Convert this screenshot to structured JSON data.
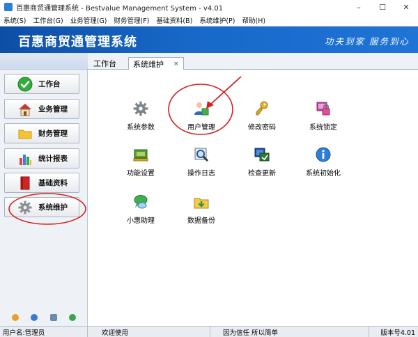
{
  "window": {
    "title": "百惠商贸通管理系统 - Bestvalue Management System - v4.01",
    "minimize": "–",
    "maximize": "☐",
    "close": "✕"
  },
  "menu": [
    "系统(S)",
    "工作台(G)",
    "业务管理(G)",
    "财务管理(F)",
    "基础资料(B)",
    "系统维护(P)",
    "帮助(H)"
  ],
  "banner": {
    "title": "百惠商贸通管理系统",
    "slogan": "功夫到家 服务到心"
  },
  "sidebar": {
    "items": [
      {
        "label": "工作台",
        "icon": "check-circle-icon"
      },
      {
        "label": "业务管理",
        "icon": "house-icon"
      },
      {
        "label": "财务管理",
        "icon": "folder-icon"
      },
      {
        "label": "统计报表",
        "icon": "bar-chart-icon"
      },
      {
        "label": "基础资料",
        "icon": "red-book-icon"
      },
      {
        "label": "系统维护",
        "icon": "gear-icon"
      }
    ]
  },
  "tabs": [
    {
      "label": "工作台"
    },
    {
      "label": "系统维护",
      "close": "×"
    }
  ],
  "functions": [
    {
      "label": "系统参数",
      "icon": "gear-icon"
    },
    {
      "label": "用户管理",
      "icon": "user-icon"
    },
    {
      "label": "修改密码",
      "icon": "key-icon"
    },
    {
      "label": "系统锁定",
      "icon": "lock-icon"
    },
    {
      "label": "功能设置",
      "icon": "module-icon"
    },
    {
      "label": "操作日志",
      "icon": "log-magnifier-icon"
    },
    {
      "label": "检查更新",
      "icon": "update-icon"
    },
    {
      "label": "系统初始化",
      "icon": "info-icon"
    },
    {
      "label": "小惠助理",
      "icon": "chat-icon"
    },
    {
      "label": "数据备份",
      "icon": "backup-folder-icon"
    }
  ],
  "status": {
    "user": "用户名:管理员",
    "welcome": "欢迎使用",
    "motto": "因为信任 所以简单",
    "version": "版本号4.01"
  },
  "colors": {
    "banner": "#1768c8",
    "annotation": "#d42020"
  }
}
